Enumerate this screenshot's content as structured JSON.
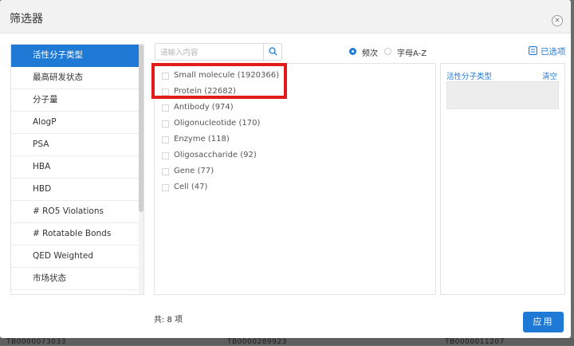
{
  "dialog": {
    "title": "筛选器",
    "close_icon": "close-icon",
    "close_glyph": "×"
  },
  "sidebar": {
    "items": [
      {
        "label": "活性分子类型",
        "active": true
      },
      {
        "label": "最高研发状态"
      },
      {
        "label": "分子量"
      },
      {
        "label": "AlogP"
      },
      {
        "label": "PSA"
      },
      {
        "label": "HBA"
      },
      {
        "label": "HBD"
      },
      {
        "label": "# RO5 Violations"
      },
      {
        "label": "# Rotatable Bonds"
      },
      {
        "label": "QED Weighted"
      },
      {
        "label": "市场状态"
      }
    ]
  },
  "search": {
    "placeholder": "请输入内容",
    "value": "",
    "icon": "search-icon"
  },
  "sort": {
    "options": [
      {
        "label": "频次",
        "checked": true
      },
      {
        "label": "字母A-Z",
        "checked": false
      }
    ]
  },
  "selected_link": {
    "label": "已选项",
    "icon": "list-check-icon"
  },
  "options": [
    {
      "label": "Small molecule (1920366)"
    },
    {
      "label": "Protein (22682)"
    },
    {
      "label": "Antibody (974)"
    },
    {
      "label": "Oligonucleotide (170)"
    },
    {
      "label": "Enzyme (118)"
    },
    {
      "label": "Oligosaccharide (92)"
    },
    {
      "label": "Gene (77)"
    },
    {
      "label": "Cell (47)"
    }
  ],
  "selected_panel": {
    "title": "活性分子类型",
    "clear_label": "清空"
  },
  "footer": {
    "count_label": "共: 8 项",
    "apply_label": "应用"
  },
  "background": {
    "row_texts": [
      "TB0000073033",
      "TB0000289923",
      "TB0000011207"
    ]
  },
  "colors": {
    "accent": "#1f7ad6",
    "highlight_border": "#e21b1b",
    "header_bg": "#f2f2f2"
  }
}
